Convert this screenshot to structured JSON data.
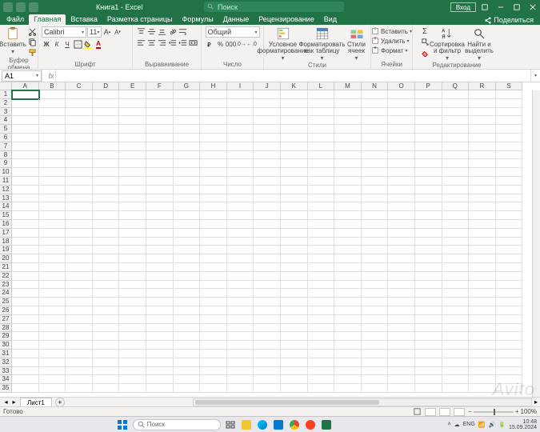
{
  "title": {
    "docname": "Книга1",
    "appname": "Excel"
  },
  "search": {
    "placeholder": "Поиск"
  },
  "signin_label": "Вход",
  "tabs": [
    "Файл",
    "Главная",
    "Вставка",
    "Разметка страницы",
    "Формулы",
    "Данные",
    "Рецензирование",
    "Вид"
  ],
  "active_tab": 1,
  "share_label": "Поделиться",
  "ribbon": {
    "clipboard": {
      "paste": "Вставить",
      "label": "Буфер обмена"
    },
    "font": {
      "family": "Calibri",
      "size": "11",
      "label": "Шрифт"
    },
    "align": {
      "label": "Выравнивание"
    },
    "number": {
      "format": "Общий",
      "label": "Число"
    },
    "styles": {
      "condfmt": "Условное форматирование",
      "astable": "Форматировать как таблицу",
      "cellstyles": "Стили ячеек",
      "label": "Стили"
    },
    "cells": {
      "insert": "Вставить",
      "delete": "Удалить",
      "format": "Формат",
      "label": "Ячейки"
    },
    "editing": {
      "sort": "Сортировка и фильтр",
      "find": "Найти и выделить",
      "label": "Редактирование"
    }
  },
  "namebox": "A1",
  "columns": [
    "A",
    "B",
    "C",
    "D",
    "E",
    "F",
    "G",
    "H",
    "I",
    "J",
    "K",
    "L",
    "M",
    "N",
    "O",
    "P",
    "Q",
    "R",
    "S"
  ],
  "row_count": 35,
  "sheet": {
    "name": "Лист1"
  },
  "status": {
    "ready": "Готово",
    "zoom": "100%"
  },
  "taskbar": {
    "search": "Поиск",
    "lang": "ENG",
    "time": "10:48",
    "date": "15.09.2024"
  },
  "watermark": "Avito"
}
